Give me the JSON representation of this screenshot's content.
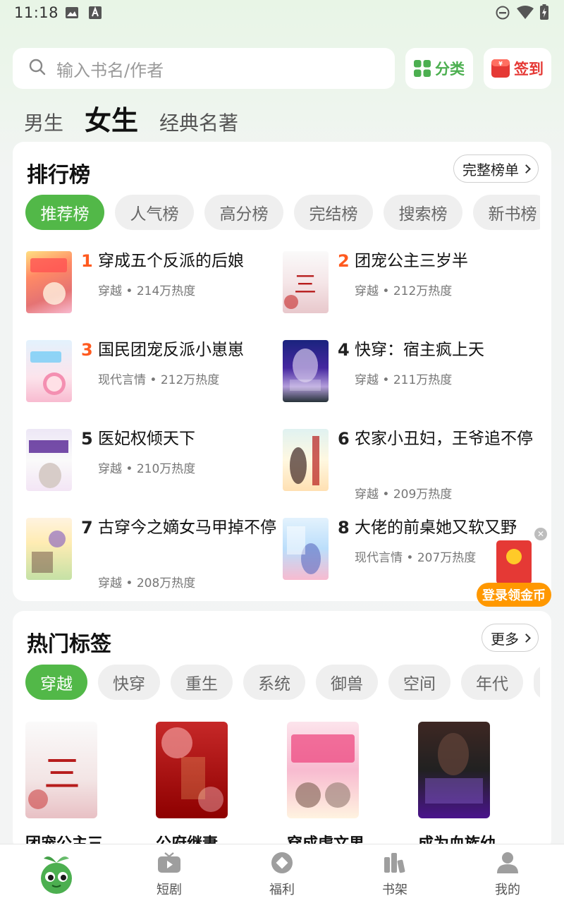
{
  "status_bar": {
    "time": "11:18",
    "left_icons": [
      "image-icon",
      "font-icon"
    ],
    "right_icons": [
      "dnd-icon",
      "wifi-icon",
      "battery-icon"
    ]
  },
  "search": {
    "placeholder": "输入书名/作者",
    "icon": "search-icon"
  },
  "header_buttons": {
    "category": {
      "label": "分类",
      "icon": "grid-icon",
      "color": "#4caf50"
    },
    "signin": {
      "label": "签到",
      "icon": "coupon-icon",
      "color": "#e53935"
    }
  },
  "gender_tabs": [
    {
      "label": "男生",
      "active": false
    },
    {
      "label": "女生",
      "active": true
    },
    {
      "label": "经典名著",
      "active": false
    }
  ],
  "ranking": {
    "title": "排行榜",
    "more": "完整榜单",
    "tabs": [
      "推荐榜",
      "人气榜",
      "高分榜",
      "完结榜",
      "搜索榜",
      "新书榜"
    ],
    "active_tab": "推荐榜",
    "items": [
      {
        "rank": "1",
        "title": "穿成五个反派的后娘",
        "meta": "穿越 • 214万热度"
      },
      {
        "rank": "2",
        "title": "团宠公主三岁半",
        "meta": "穿越 • 212万热度"
      },
      {
        "rank": "3",
        "title": "国民团宠反派小崽崽",
        "meta": "现代言情 • 212万热度"
      },
      {
        "rank": "4",
        "title": "快穿：宿主疯上天",
        "meta": "穿越 • 211万热度"
      },
      {
        "rank": "5",
        "title": "医妃权倾天下",
        "meta": "穿越 • 210万热度"
      },
      {
        "rank": "6",
        "title": "农家小丑妇，王爷追不停",
        "meta": "穿越 • 209万热度"
      },
      {
        "rank": "7",
        "title": "古穿今之嫡女马甲掉不停",
        "meta": "穿越 • 208万热度"
      },
      {
        "rank": "8",
        "title": "大佬的前桌她又软又野",
        "meta": "现代言情 • 207万热度"
      }
    ]
  },
  "hot_tags": {
    "title": "热门标签",
    "more": "更多",
    "tabs": [
      "穿越",
      "快穿",
      "重生",
      "系统",
      "御兽",
      "空间",
      "年代"
    ],
    "active_tab": "穿越",
    "books": [
      {
        "title": "团宠公主三"
      },
      {
        "title": "公府继妻"
      },
      {
        "title": "穿成虐文男"
      },
      {
        "title": "成为血族幼"
      }
    ]
  },
  "float_reward": {
    "label": "登录领金币",
    "icon": "red-packet-icon"
  },
  "bottom_nav": [
    {
      "label": "",
      "icon": "home-mascot-icon",
      "active": true
    },
    {
      "label": "短剧",
      "icon": "tv-icon",
      "active": false
    },
    {
      "label": "福利",
      "icon": "gift-icon",
      "active": false
    },
    {
      "label": "书架",
      "icon": "bookshelf-icon",
      "active": false
    },
    {
      "label": "我的",
      "icon": "user-icon",
      "active": false
    }
  ]
}
